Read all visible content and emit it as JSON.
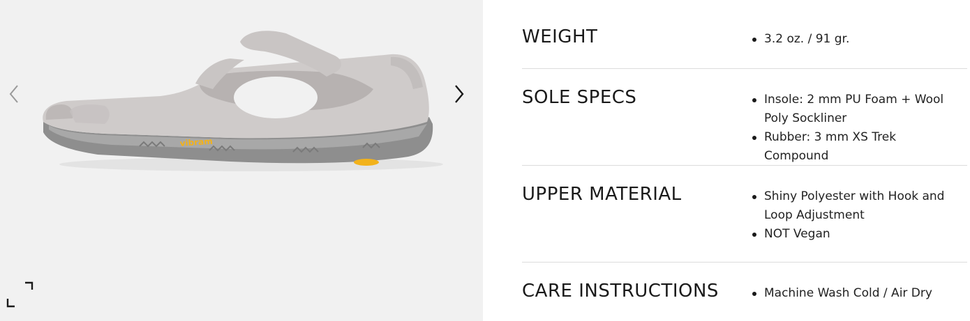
{
  "gallery": {
    "product_image": "shoe-side-view",
    "brand_logo": "vibram",
    "prev_icon": "chevron-left-icon",
    "next_icon": "chevron-right-icon",
    "expand_icon": "expand-icon"
  },
  "specs": [
    {
      "label": "WEIGHT",
      "values": [
        "3.2 oz. / 91 gr."
      ]
    },
    {
      "label": "SOLE SPECS",
      "values": [
        "Insole: 2 mm PU Foam + Wool Poly Sockliner",
        "Rubber: 3 mm XS Trek Compound"
      ]
    },
    {
      "label": "UPPER MATERIAL",
      "values": [
        "Shiny Polyester with Hook and Loop Adjustment",
        "NOT Vegan"
      ]
    },
    {
      "label": "CARE INSTRUCTIONS",
      "values": [
        "Machine Wash Cold / Air Dry"
      ]
    }
  ],
  "colors": {
    "gallery_bg": "#f1f1f1",
    "shoe_upper": "#cfcbca",
    "sole": "#8e8e8e",
    "accent": "#f2b21b",
    "divider": "#dcdcdc"
  }
}
